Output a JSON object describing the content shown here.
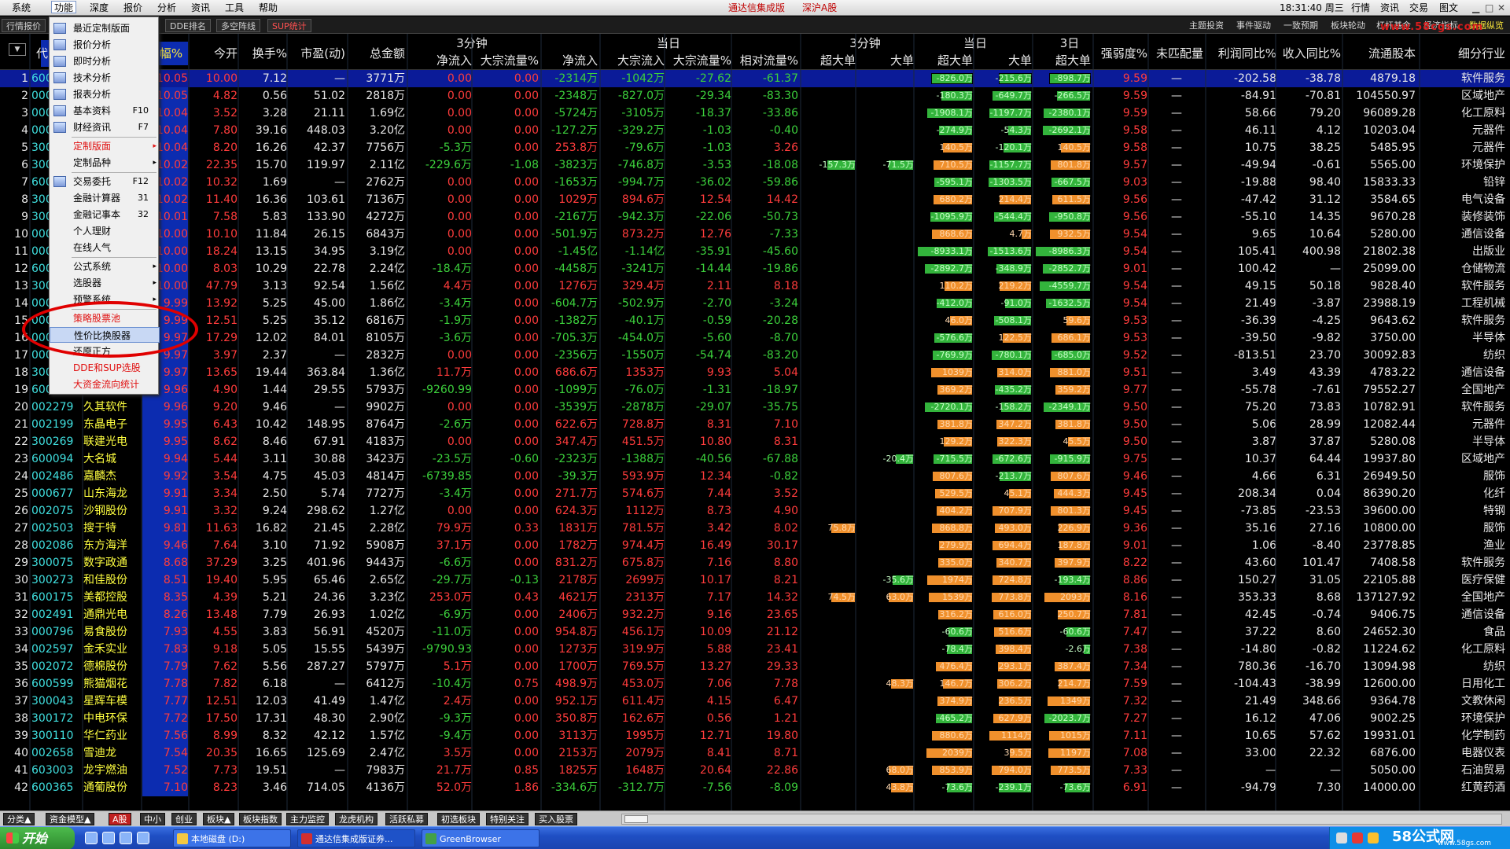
{
  "menubar": {
    "items": [
      "系统",
      "功能",
      "深度",
      "报价",
      "分析",
      "资讯",
      "工具",
      "帮助"
    ],
    "title": "通达信集成版",
    "title_sub": "深沪A股",
    "clock": "18:31:40 周三",
    "right": [
      "行情",
      "资讯",
      "交易",
      "图文"
    ]
  },
  "toolbar": {
    "tabs": [
      "行情报价",
      "",
      "DDE排名",
      "多空阵线",
      "SUP统计"
    ],
    "buttons": [
      "主题投资",
      "事件驱动",
      "一致预期",
      "板块轮动",
      "杠杆基金",
      "经济指标",
      "数据纵览"
    ],
    "watermark": "www.58cgs.com"
  },
  "header": {
    "select_label": "代",
    "sort_label": "涨幅%",
    "groups": [
      "3分钟",
      "当日",
      "3分钟",
      "当日",
      "3日"
    ],
    "cols": [
      "今开",
      "换手%",
      "市盈(动)",
      "总金额",
      "净流入",
      "大宗流量%",
      "净流入",
      "大宗流入",
      "大宗流量%",
      "相对流量%",
      "超大单",
      "大单",
      "超大单",
      "大单",
      "超大单",
      "强弱度%",
      "未匹配量",
      "利润同比%",
      "收入同比%",
      "流通股本",
      "细分行业"
    ],
    "dd_icon": "▼"
  },
  "dropdown": {
    "items": [
      {
        "label": "最近定制版面",
        "icon": "grid-icon"
      },
      {
        "label": "报价分析",
        "icon": "table-icon"
      },
      {
        "label": "即时分析",
        "icon": "chart-icon"
      },
      {
        "label": "技术分析",
        "icon": "kline-icon"
      },
      {
        "label": "报表分析",
        "icon": "report-icon"
      },
      {
        "label": "基本资料",
        "shortcut": "F10",
        "icon": "doc-icon"
      },
      {
        "label": "财经资讯",
        "shortcut": "F7",
        "icon": "news-icon"
      },
      {
        "label": "定制版面",
        "red": true,
        "arrow": "▸"
      },
      {
        "label": "定制品种",
        "arrow": "▸"
      },
      {
        "label": "交易委托",
        "shortcut": "F12",
        "icon": "trade-icon"
      },
      {
        "label": "金融计算器",
        "shortcut": "31"
      },
      {
        "label": "金融记事本",
        "shortcut": "32"
      },
      {
        "label": "个人理财"
      },
      {
        "label": "在线人气"
      },
      {
        "label": "公式系统",
        "arrow": "▸"
      },
      {
        "label": "选股器",
        "arrow": "▸"
      },
      {
        "label": "预警系统",
        "arrow": "▸"
      },
      {
        "label": "策略股票池",
        "red": true
      },
      {
        "label": "性价比换股器",
        "highlight": true
      },
      {
        "label": "还原正方"
      },
      {
        "label": "DDE和SUP选股",
        "red": true
      },
      {
        "label": "大资金流向统计",
        "red": true
      }
    ]
  },
  "rows": [
    [
      "1",
      "600XXX",
      "",
      "10.05",
      "10.00",
      "7.12",
      "—",
      "3771万",
      "0.00",
      "0.00",
      "-2314万",
      "-1042万",
      "-27.62",
      "-61.37",
      "",
      "",
      "-826.0万",
      "-215.6万",
      "-898.7万",
      "9.59",
      "—",
      "-202.58",
      "-38.78",
      "4879.18",
      "软件服务"
    ],
    [
      "2",
      "000XXX",
      "",
      "10.05",
      "4.82",
      "0.56",
      "51.02",
      "2818万",
      "0.00",
      "0.00",
      "-2348万",
      "-827.0万",
      "-29.34",
      "-83.30",
      "",
      "",
      "-180.3万",
      "-649.7万",
      "-266.5万",
      "9.59",
      "—",
      "-84.91",
      "-70.81",
      "104550.97",
      "区域地产"
    ],
    [
      "3",
      "000XXX",
      "",
      "10.04",
      "3.52",
      "3.28",
      "21.11",
      "1.69亿",
      "0.00",
      "0.00",
      "-5724万",
      "-3105万",
      "-18.37",
      "-33.86",
      "",
      "",
      "-1908.1万",
      "-1197.7万",
      "-2380.1万",
      "9.59",
      "—",
      "58.66",
      "79.20",
      "96089.28",
      "化工原料"
    ],
    [
      "4",
      "000XXX",
      "",
      "10.04",
      "7.80",
      "39.16",
      "448.03",
      "3.20亿",
      "0.00",
      "0.00",
      "-127.2万",
      "-329.2万",
      "-1.03",
      "-0.40",
      "",
      "",
      "-274.9万",
      "-54.3万",
      "-2692.1万",
      "9.58",
      "—",
      "46.11",
      "4.12",
      "10203.04",
      "元器件"
    ],
    [
      "5",
      "300XXX",
      "",
      "10.04",
      "8.20",
      "16.26",
      "42.37",
      "7756万",
      "-5.3万",
      "0.00",
      "253.8万",
      "-79.6万",
      "-1.03",
      "3.26",
      "",
      "",
      "140.5万",
      "-120.1万",
      "140.5万",
      "9.58",
      "—",
      "10.75",
      "38.25",
      "5485.95",
      "元器件"
    ],
    [
      "6",
      "300XXX",
      "",
      "10.02",
      "22.35",
      "15.70",
      "119.97",
      "2.11亿",
      "-229.6万",
      "-1.08",
      "-3823万",
      "-746.8万",
      "-3.53",
      "-18.08",
      "-157.3万",
      "-71.5万",
      "710.5万",
      "-1157.7万",
      "801.8万",
      "9.57",
      "—",
      "-49.94",
      "-0.61",
      "5565.00",
      "环境保护"
    ],
    [
      "7",
      "600XXX",
      "",
      "10.02",
      "10.32",
      "1.69",
      "—",
      "2762万",
      "0.00",
      "0.00",
      "-1653万",
      "-994.7万",
      "-36.02",
      "-59.86",
      "",
      "",
      "-595.1万",
      "-1303.5万",
      "-667.5万",
      "9.03",
      "—",
      "-19.88",
      "98.40",
      "15833.33",
      "铅锌"
    ],
    [
      "8",
      "300XXX",
      "",
      "10.02",
      "11.40",
      "16.36",
      "103.61",
      "7136万",
      "0.00",
      "0.00",
      "1029万",
      "894.6万",
      "12.54",
      "14.42",
      "",
      "",
      "680.2万",
      "214.4万",
      "611.5万",
      "9.56",
      "—",
      "-47.42",
      "31.12",
      "3584.65",
      "电气设备"
    ],
    [
      "9",
      "300XXX",
      "",
      "10.01",
      "7.58",
      "5.83",
      "133.90",
      "4272万",
      "0.00",
      "0.00",
      "-2167万",
      "-942.3万",
      "-22.06",
      "-50.73",
      "",
      "",
      "-1095.9万",
      "-544.4万",
      "-950.8万",
      "9.56",
      "—",
      "-55.10",
      "14.35",
      "9670.28",
      "装修装饰"
    ],
    [
      "10",
      "000XXX",
      "",
      "10.00",
      "10.10",
      "11.84",
      "26.15",
      "6843万",
      "0.00",
      "0.00",
      "-501.9万",
      "873.2万",
      "12.76",
      "-7.33",
      "",
      "",
      "868.6万",
      "4.7万",
      "932.5万",
      "9.54",
      "—",
      "9.65",
      "10.64",
      "5280.00",
      "通信设备"
    ],
    [
      "11",
      "000XXX",
      "",
      "10.00",
      "18.24",
      "13.15",
      "34.95",
      "3.19亿",
      "0.00",
      "0.00",
      "-1.45亿",
      "-1.14亿",
      "-35.91",
      "-45.60",
      "",
      "",
      "-8933.1万",
      "-1513.6万",
      "-8986.3万",
      "9.54",
      "—",
      "105.41",
      "400.98",
      "21802.38",
      "出版业"
    ],
    [
      "12",
      "600XXX",
      "",
      "10.00",
      "8.03",
      "10.29",
      "22.78",
      "2.24亿",
      "-18.4万",
      "0.00",
      "-4458万",
      "-3241万",
      "-14.44",
      "-19.86",
      "",
      "",
      "-2892.7万",
      "-348.9万",
      "-2852.7万",
      "9.01",
      "—",
      "100.42",
      "—",
      "25099.00",
      "仓储物流"
    ],
    [
      "13",
      "300XXX",
      "",
      "10.00",
      "47.79",
      "3.13",
      "92.54",
      "1.56亿",
      "4.4万",
      "0.00",
      "1276万",
      "329.4万",
      "2.11",
      "8.18",
      "",
      "",
      "110.2万",
      "219.2万",
      "-4559.7万",
      "9.54",
      "—",
      "49.15",
      "50.18",
      "9828.40",
      "软件服务"
    ],
    [
      "14",
      "000XXX",
      "",
      "9.99",
      "13.92",
      "5.25",
      "45.00",
      "1.86亿",
      "-3.4万",
      "0.00",
      "-604.7万",
      "-502.9万",
      "-2.70",
      "-3.24",
      "",
      "",
      "-412.0万",
      "-91.0万",
      "-1632.5万",
      "9.54",
      "—",
      "21.49",
      "-3.87",
      "23988.19",
      "工程机械"
    ],
    [
      "15",
      "000XXX",
      "",
      "9.99",
      "12.51",
      "5.25",
      "35.12",
      "6816万",
      "-1.9万",
      "0.00",
      "-1382万",
      "-40.1万",
      "-0.59",
      "-20.28",
      "",
      "",
      "46.0万",
      "-508.1万",
      "59.6万",
      "9.53",
      "—",
      "-36.39",
      "-4.25",
      "9643.62",
      "软件服务"
    ],
    [
      "16",
      "000XXX",
      "",
      "9.97",
      "17.29",
      "12.02",
      "84.01",
      "8105万",
      "-3.6万",
      "0.00",
      "-705.3万",
      "-454.0万",
      "-5.60",
      "-8.70",
      "",
      "",
      "-576.6万",
      "122.5万",
      "686.1万",
      "9.53",
      "—",
      "-39.50",
      "-9.82",
      "3750.00",
      "半导体"
    ],
    [
      "17",
      "000XXX",
      "",
      "9.97",
      "3.97",
      "2.37",
      "—",
      "2832万",
      "0.00",
      "0.00",
      "-2356万",
      "-1550万",
      "-54.74",
      "-83.20",
      "",
      "",
      "-769.9万",
      "-780.1万",
      "-685.0万",
      "9.52",
      "—",
      "-813.51",
      "23.70",
      "30092.83",
      "纺织"
    ],
    [
      "18",
      "300XXX",
      "",
      "9.97",
      "13.65",
      "19.44",
      "363.84",
      "1.36亿",
      "11.7万",
      "0.00",
      "686.6万",
      "1353万",
      "9.93",
      "5.04",
      "",
      "",
      "1039万",
      "314.0万",
      "881.0万",
      "9.51",
      "—",
      "3.49",
      "43.39",
      "4783.22",
      "通信设备"
    ],
    [
      "19",
      "600XXX",
      "",
      "9.96",
      "4.90",
      "1.44",
      "29.55",
      "5793万",
      "-9260.99",
      "0.00",
      "-1099万",
      "-76.0万",
      "-1.31",
      "-18.97",
      "",
      "",
      "369.2万",
      "-435.2万",
      "359.2万",
      "9.77",
      "—",
      "-55.78",
      "-7.61",
      "79552.27",
      "全国地产"
    ],
    [
      "20",
      "002279",
      "久其软件",
      "9.96",
      "9.20",
      "9.46",
      "—",
      "9902万",
      "0.00",
      "0.00",
      "-3539万",
      "-2878万",
      "-29.07",
      "-35.75",
      "",
      "",
      "-2720.1万",
      "-158.2万",
      "-2349.1万",
      "9.50",
      "—",
      "75.20",
      "73.83",
      "10782.91",
      "软件服务"
    ],
    [
      "21",
      "002199",
      "东晶电子",
      "9.95",
      "6.43",
      "10.42",
      "148.95",
      "8764万",
      "-2.6万",
      "0.00",
      "622.6万",
      "728.8万",
      "8.31",
      "7.10",
      "",
      "",
      "381.8万",
      "347.2万",
      "381.8万",
      "9.50",
      "—",
      "5.06",
      "28.99",
      "12082.44",
      "元器件"
    ],
    [
      "22",
      "300269",
      "联建光电",
      "9.95",
      "8.62",
      "8.46",
      "67.91",
      "4183万",
      "0.00",
      "0.00",
      "347.4万",
      "451.5万",
      "10.80",
      "8.31",
      "",
      "",
      "129.2万",
      "322.3万",
      "45.5万",
      "9.50",
      "—",
      "3.87",
      "37.87",
      "5280.08",
      "半导体"
    ],
    [
      "23",
      "600094",
      "大名城",
      "9.94",
      "5.44",
      "3.11",
      "30.88",
      "3423万",
      "-23.5万",
      "-0.60",
      "-2323万",
      "-1388万",
      "-40.56",
      "-67.88",
      "",
      "-20.4万",
      "-715.5万",
      "-672.6万",
      "-915.9万",
      "9.75",
      "—",
      "10.37",
      "64.44",
      "19937.80",
      "区域地产"
    ],
    [
      "24",
      "002486",
      "嘉麟杰",
      "9.92",
      "3.54",
      "4.75",
      "45.03",
      "4814万",
      "-6739.85",
      "0.00",
      "-39.3万",
      "593.9万",
      "12.34",
      "-0.82",
      "",
      "",
      "807.6万",
      "-213.7万",
      "807.6万",
      "9.46",
      "—",
      "4.66",
      "6.31",
      "26949.50",
      "服饰"
    ],
    [
      "25",
      "000677",
      "山东海龙",
      "9.91",
      "3.34",
      "2.50",
      "5.74",
      "7727万",
      "-3.4万",
      "0.00",
      "271.7万",
      "574.6万",
      "7.44",
      "3.52",
      "",
      "",
      "529.5万",
      "45.1万",
      "444.3万",
      "9.45",
      "—",
      "208.34",
      "0.04",
      "86390.20",
      "化纤"
    ],
    [
      "26",
      "002075",
      "沙钢股份",
      "9.91",
      "3.32",
      "9.24",
      "298.62",
      "1.27亿",
      "0.00",
      "0.00",
      "624.3万",
      "1112万",
      "8.73",
      "4.90",
      "",
      "",
      "404.2万",
      "707.9万",
      "801.3万",
      "9.45",
      "—",
      "-73.85",
      "-23.53",
      "39600.00",
      "特钢"
    ],
    [
      "27",
      "002503",
      "搜于特",
      "9.81",
      "11.63",
      "16.82",
      "21.45",
      "2.28亿",
      "79.9万",
      "0.33",
      "1831万",
      "781.5万",
      "3.42",
      "8.02",
      "75.8万",
      "",
      "868.8万",
      "493.0万",
      "226.9万",
      "9.36",
      "—",
      "35.16",
      "27.16",
      "10800.00",
      "服饰"
    ],
    [
      "28",
      "002086",
      "东方海洋",
      "9.46",
      "7.64",
      "3.10",
      "71.92",
      "5908万",
      "37.1万",
      "0.00",
      "1782万",
      "974.4万",
      "16.49",
      "30.17",
      "",
      "",
      "279.9万",
      "694.4万",
      "187.8万",
      "9.01",
      "—",
      "1.06",
      "-8.40",
      "23778.85",
      "渔业"
    ],
    [
      "29",
      "300075",
      "数字政通",
      "8.68",
      "37.29",
      "3.25",
      "401.96",
      "9443万",
      "-6.6万",
      "0.00",
      "831.2万",
      "675.8万",
      "7.16",
      "8.80",
      "",
      "",
      "335.0万",
      "340.7万",
      "397.9万",
      "8.22",
      "—",
      "43.60",
      "101.47",
      "7408.58",
      "软件服务"
    ],
    [
      "30",
      "300273",
      "和佳股份",
      "8.51",
      "19.40",
      "5.95",
      "65.46",
      "2.65亿",
      "-29.7万",
      "-0.13",
      "2178万",
      "2699万",
      "10.17",
      "8.21",
      "",
      "-35.6万",
      "1974万",
      "724.8万",
      "-193.4万",
      "8.86",
      "—",
      "150.27",
      "31.05",
      "22105.88",
      "医疗保健"
    ],
    [
      "31",
      "600175",
      "美都控股",
      "8.35",
      "4.39",
      "5.21",
      "24.36",
      "3.23亿",
      "253.0万",
      "0.43",
      "4621万",
      "2313万",
      "7.17",
      "14.32",
      "74.5万",
      "63.0万",
      "1539万",
      "773.8万",
      "2093万",
      "8.16",
      "—",
      "353.33",
      "8.68",
      "137127.92",
      "全国地产"
    ],
    [
      "32",
      "002491",
      "通鼎光电",
      "8.26",
      "13.48",
      "7.79",
      "26.93",
      "1.02亿",
      "-6.9万",
      "0.00",
      "2406万",
      "932.2万",
      "9.16",
      "23.65",
      "",
      "",
      "316.2万",
      "616.0万",
      "250.7万",
      "7.81",
      "—",
      "42.45",
      "-0.74",
      "9406.75",
      "通信设备"
    ],
    [
      "33",
      "000796",
      "易食股份",
      "7.93",
      "4.55",
      "3.83",
      "56.91",
      "4520万",
      "-11.0万",
      "0.00",
      "954.8万",
      "456.1万",
      "10.09",
      "21.12",
      "",
      "",
      "-60.6万",
      "516.6万",
      "-60.6万",
      "7.47",
      "—",
      "37.22",
      "8.60",
      "24652.30",
      "食品"
    ],
    [
      "34",
      "002597",
      "金禾实业",
      "7.83",
      "9.18",
      "5.05",
      "15.55",
      "5439万",
      "-9790.93",
      "0.00",
      "1273万",
      "319.9万",
      "5.88",
      "23.41",
      "",
      "",
      "-78.4万",
      "398.4万",
      "-2.6万",
      "7.38",
      "—",
      "-14.80",
      "-0.82",
      "11224.62",
      "化工原料"
    ],
    [
      "35",
      "002072",
      "德棉股份",
      "7.79",
      "7.62",
      "5.56",
      "287.27",
      "5797万",
      "5.1万",
      "0.00",
      "1700万",
      "769.5万",
      "13.27",
      "29.33",
      "",
      "",
      "476.4万",
      "293.1万",
      "387.4万",
      "7.34",
      "—",
      "780.36",
      "-16.70",
      "13094.98",
      "纺织"
    ],
    [
      "36",
      "600599",
      "熊猫烟花",
      "7.78",
      "7.82",
      "6.18",
      "—",
      "6412万",
      "-10.4万",
      "0.75",
      "498.9万",
      "453.0万",
      "7.06",
      "7.78",
      "",
      "48.3万",
      "146.7万",
      "306.2万",
      "214.7万",
      "7.59",
      "—",
      "-104.43",
      "-38.99",
      "12600.00",
      "日用化工"
    ],
    [
      "37",
      "300043",
      "星辉车模",
      "7.77",
      "12.51",
      "12.03",
      "41.49",
      "1.47亿",
      "2.4万",
      "0.00",
      "952.1万",
      "611.4万",
      "4.15",
      "6.47",
      "",
      "",
      "374.9万",
      "236.5万",
      "1349万",
      "7.32",
      "—",
      "21.49",
      "348.66",
      "9364.78",
      "文教休闲"
    ],
    [
      "38",
      "300172",
      "中电环保",
      "7.72",
      "17.50",
      "17.31",
      "48.30",
      "2.90亿",
      "-9.3万",
      "0.00",
      "350.8万",
      "162.6万",
      "0.56",
      "1.21",
      "",
      "",
      "-465.2万",
      "627.9万",
      "-2023.7万",
      "7.27",
      "—",
      "16.12",
      "47.06",
      "9002.25",
      "环境保护"
    ],
    [
      "39",
      "300110",
      "华仁药业",
      "7.56",
      "8.99",
      "8.32",
      "42.12",
      "1.57亿",
      "-9.4万",
      "0.00",
      "3113万",
      "1995万",
      "12.71",
      "19.80",
      "",
      "",
      "880.6万",
      "1114万",
      "1015万",
      "7.11",
      "—",
      "10.65",
      "57.62",
      "19931.01",
      "化学制药"
    ],
    [
      "40",
      "002658",
      "雪迪龙",
      "7.54",
      "20.35",
      "16.65",
      "125.69",
      "2.47亿",
      "3.5万",
      "0.00",
      "2153万",
      "2079万",
      "8.41",
      "8.71",
      "",
      "",
      "2039万",
      "39.5万",
      "1197万",
      "7.08",
      "—",
      "33.00",
      "22.32",
      "6876.00",
      "电器仪表"
    ],
    [
      "41",
      "603003",
      "龙宇燃油",
      "7.52",
      "7.73",
      "19.51",
      "—",
      "7983万",
      "21.7万",
      "0.85",
      "1825万",
      "1648万",
      "20.64",
      "22.86",
      "",
      "68.0万",
      "853.9万",
      "794.0万",
      "773.5万",
      "7.33",
      "—",
      "—",
      "—",
      "5050.00",
      "石油贸易"
    ],
    [
      "42",
      "600365",
      "通葡股份",
      "7.10",
      "8.23",
      "3.46",
      "714.05",
      "4136万",
      "52.0万",
      "1.86",
      "-334.6万",
      "-312.7万",
      "-7.56",
      "-8.09",
      "",
      "43.8万",
      "-73.6万",
      "-239.1万",
      "-73.6万",
      "6.91",
      "—",
      "-94.79",
      "7.30",
      "14000.00",
      "红黄药酒"
    ]
  ],
  "bottom_tabs": [
    "分类▲",
    "资金模型▲",
    "A股",
    "中小",
    "创业",
    "板块▲",
    "板块指数",
    "主力监控",
    "龙虎机构",
    "活跃私募",
    "初选板块",
    "特别关注",
    "买入股票"
  ],
  "taskbar": {
    "start": "开始",
    "tasks": [
      "本地磁盘 (D:)",
      "通达信集成版证券...",
      "GreenBrowser"
    ],
    "brand": "58公式网",
    "brand_url": "www.58gs.com"
  }
}
